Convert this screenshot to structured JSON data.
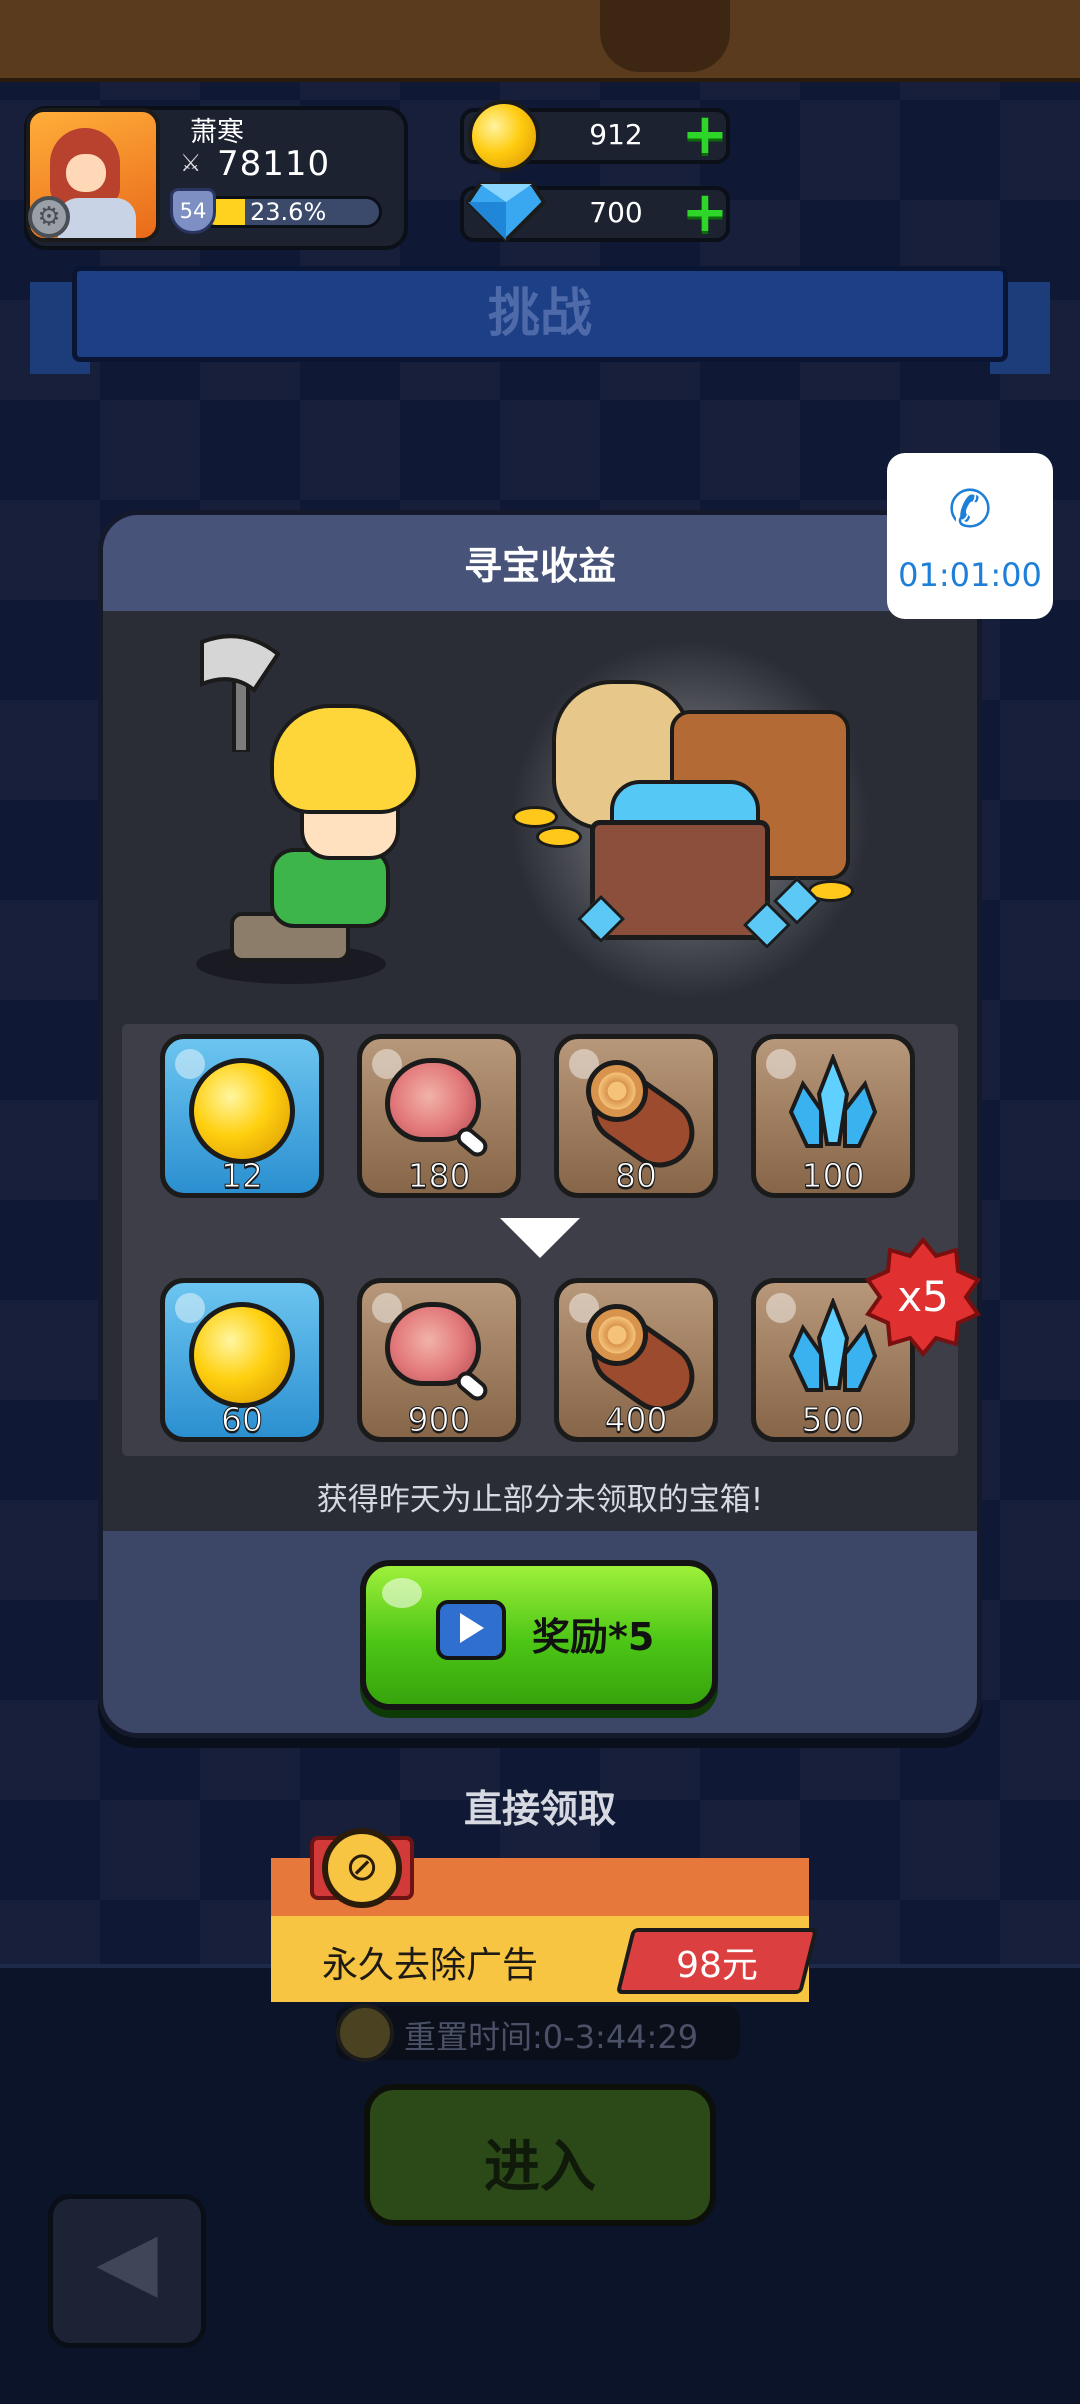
{
  "player": {
    "name": "萧寒",
    "power": "78110",
    "level": "54",
    "xp_percent": "23.6%",
    "xp_fraction": 0.236
  },
  "currency": {
    "gold": "912",
    "gems": "700"
  },
  "page_title": "挑战",
  "call_widget": {
    "timer": "01:01:00",
    "icon": "phone-icon"
  },
  "modal": {
    "title": "寻宝收益",
    "base_rewards": [
      {
        "item": "gold-coin",
        "amount": "12"
      },
      {
        "item": "meat",
        "amount": "180"
      },
      {
        "item": "wood-log",
        "amount": "80"
      },
      {
        "item": "blue-crystal",
        "amount": "100"
      }
    ],
    "multiplied_rewards": [
      {
        "item": "gold-coin",
        "amount": "60"
      },
      {
        "item": "meat",
        "amount": "900"
      },
      {
        "item": "wood-log",
        "amount": "400"
      },
      {
        "item": "blue-crystal",
        "amount": "500"
      }
    ],
    "multiplier_badge": "x5",
    "info_text": "获得昨天为止部分未领取的宝箱!",
    "reward_button_label": "奖励*5"
  },
  "direct_claim_label": "直接领取",
  "ad_removal": {
    "label": "永久去除广告",
    "price": "98元"
  },
  "reset": {
    "text": "重置时间:0-3:44:29"
  },
  "enter_button_label": "进入",
  "colors": {
    "background": "#0f1834",
    "modal": "#3c4666",
    "reward_button": "#4cc616",
    "price_tag": "#dc3f3f",
    "call_accent": "#1e7fd8"
  }
}
